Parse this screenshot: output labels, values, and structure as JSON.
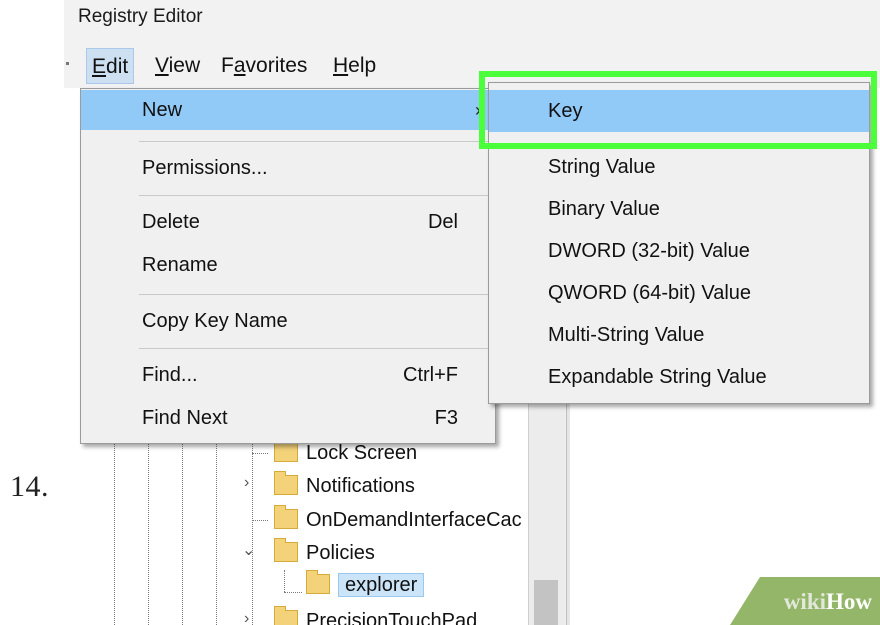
{
  "step_number": "14.",
  "window": {
    "title": "Registry Editor"
  },
  "menubar": {
    "items": [
      {
        "label": "Edit",
        "underline": "E",
        "rest": "dit",
        "active": true
      },
      {
        "label": "View",
        "underline": "V",
        "rest": "iew"
      },
      {
        "label": "Favorites",
        "pre": "F",
        "underline": "a",
        "rest": "vorites"
      },
      {
        "label": "Help",
        "underline": "H",
        "rest": "elp"
      }
    ]
  },
  "edit_menu": {
    "items": [
      {
        "label": "New",
        "submenu_arrow": "›",
        "highlighted": true
      },
      {
        "label": "Permissions..."
      },
      {
        "label": "Delete",
        "shortcut": "Del"
      },
      {
        "label": "Rename"
      },
      {
        "label": "Copy Key Name"
      },
      {
        "label": "Find...",
        "shortcut": "Ctrl+F"
      },
      {
        "label": "Find Next",
        "shortcut": "F3"
      }
    ]
  },
  "new_submenu": {
    "items": [
      {
        "label": "Key",
        "highlighted": true
      },
      {
        "label": "String Value"
      },
      {
        "label": "Binary Value"
      },
      {
        "label": "DWORD (32-bit) Value"
      },
      {
        "label": "QWORD (64-bit) Value"
      },
      {
        "label": "Multi-String Value"
      },
      {
        "label": "Expandable String Value"
      }
    ]
  },
  "tree": {
    "rows": [
      {
        "label": "Lock Screen"
      },
      {
        "label": "Notifications",
        "expander": "›"
      },
      {
        "label": "OnDemandInterfaceCac"
      },
      {
        "label": "Policies",
        "expander": "⌄"
      },
      {
        "label": "explorer",
        "selected": true
      },
      {
        "label": "PrecisionTouchPad",
        "expander": "›"
      }
    ]
  },
  "watermark": {
    "wiki": "wiki",
    "how": "How"
  },
  "colors": {
    "callout": "#4cff3b",
    "menu_highlight": "#91c9f7",
    "menu_bg": "#f0f0f0",
    "watermark_bg": "#93b668"
  }
}
